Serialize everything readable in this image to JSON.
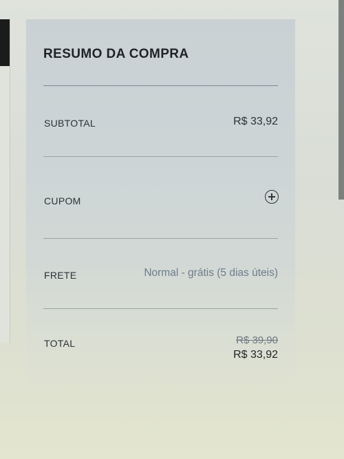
{
  "summary": {
    "title": "RESUMO DA COMPRA",
    "subtotal_label": "SUBTOTAL",
    "subtotal_value": "R$ 33,92",
    "coupon_label": "CUPOM",
    "coupon_action_icon": "plus-circle-icon",
    "shipping_label": "FRETE",
    "shipping_value": "Normal - grátis (5 dias úteis)",
    "total_label": "TOTAL",
    "total_old_value": "R$ 39,90",
    "total_value": "R$ 33,92"
  },
  "colors": {
    "card_background": "#ccd4d6",
    "text_primary": "#1e2326",
    "shipping_text": "#6d7c8c"
  }
}
